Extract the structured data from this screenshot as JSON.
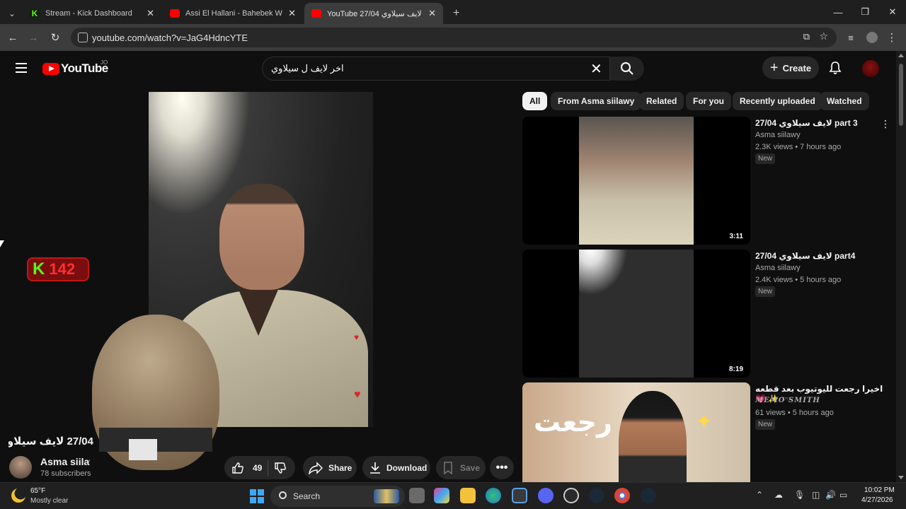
{
  "browser": {
    "tabs": [
      {
        "title": "Stream - Kick Dashboard",
        "favicon_color": "#53fc18"
      },
      {
        "title": "Assi El Hallani - Bahebek We Bg",
        "favicon_color": "#ff0000"
      },
      {
        "title": "YouTube 27/04 لايف سيلاوي",
        "favicon_color": "#ff0000"
      }
    ],
    "url": "youtube.com/watch?v=JaG4HdncYTE"
  },
  "header": {
    "logo_text": "YouTube",
    "country_code": "JO",
    "search_value": "اخر لايف ل سيلاوي",
    "create_label": "Create"
  },
  "overlay": {
    "kick_letter": "K",
    "viewer_count": "142"
  },
  "video": {
    "title": "27/04 لايف سيلاوي",
    "channel_name": "Asma siilawy",
    "subscribers": "78 subscribers",
    "like_count": "49",
    "share_label": "Share",
    "download_label": "Download",
    "save_label": "Save"
  },
  "chips": [
    "All",
    "From Asma siilawy",
    "Related",
    "For you",
    "Recently uploaded",
    "Watched"
  ],
  "recommendations": [
    {
      "title": "لايف سيلاوي 27/04 part 3",
      "channel": "Asma siilawy",
      "meta": "2.3K views • 7 hours ago",
      "badge": "New",
      "duration": "3:11"
    },
    {
      "title": "لايف سيلاوي 27/04 part4",
      "channel": "Asma siilawy",
      "meta": "2.4K views • 5 hours ago",
      "badge": "New",
      "duration": "8:19"
    },
    {
      "title": "اخيرا رجعت لليوتيوب بعد قطعه 🕶️ ✨ 💗",
      "channel": "MEMO SMITH",
      "meta": "61 views • 5 hours ago",
      "badge": "New",
      "thumb_text": "رجعت"
    }
  ],
  "taskbar": {
    "weather_temp": "65°F",
    "weather_desc": "Mostly clear",
    "search_label": "Search",
    "time": "10:02 PM",
    "date": "4/27/2026"
  },
  "colors": {
    "brand_red": "#ff0000",
    "kick_green": "#53fc18",
    "background": "#0f0f0f"
  }
}
